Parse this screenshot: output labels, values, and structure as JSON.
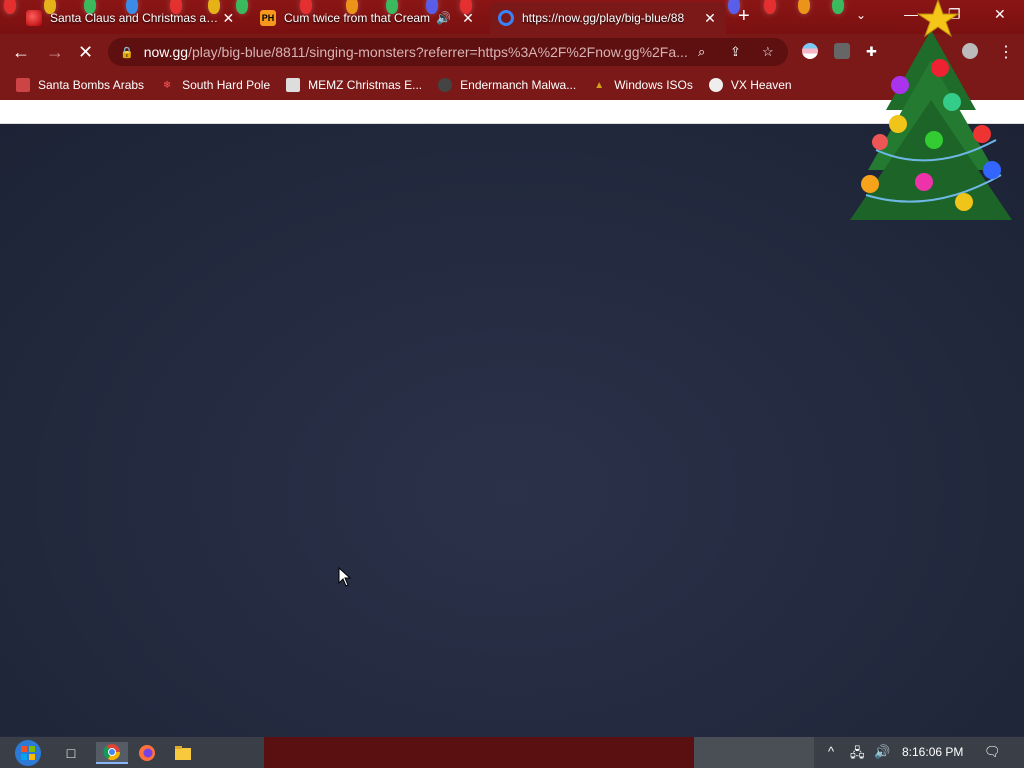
{
  "tabs": [
    {
      "title": "Santa Claus and Christmas at the",
      "favicon": "santa-icon",
      "close": "✕"
    },
    {
      "title": "Cum twice from that Cream",
      "favicon": "ph-icon",
      "favicon_text": "PH",
      "audio": "🔊",
      "close": "✕"
    },
    {
      "title": "https://now.gg/play/big-blue/88",
      "favicon": "nowgg-icon",
      "close": "✕"
    }
  ],
  "new_tab_label": "+",
  "tab_search": "⌄",
  "window_controls": {
    "minimize": "—",
    "restore": "❐",
    "close": "✕"
  },
  "toolbar": {
    "back": "←",
    "forward": "→",
    "stop": "✕",
    "url_host": "now.gg",
    "url_rest": "/play/big-blue/8811/singing-monsters?referrer=https%3A%2F%2Fnow.gg%2Fa...",
    "icons": {
      "search": "⌕",
      "share": "⇪",
      "star": "☆",
      "extensions": "✚",
      "menu": "⋮"
    }
  },
  "bookmarks": [
    {
      "label": "Santa Bombs Arabs",
      "icon": "santa-icon"
    },
    {
      "label": "South Hard Pole",
      "icon": "snowflake-icon"
    },
    {
      "label": "MEMZ Christmas E...",
      "icon": "memz-icon"
    },
    {
      "label": "Endermanch Malwa...",
      "icon": "enderman-icon"
    },
    {
      "label": "Windows ISOs",
      "icon": "tree-icon"
    },
    {
      "label": "VX Heaven",
      "icon": "vx-icon"
    }
  ],
  "taskbar": {
    "clock": "8:16:06 PM",
    "apps": [
      "start-orb-icon",
      "task-view-icon",
      "chrome-icon",
      "firefox-icon",
      "file-explorer-icon"
    ],
    "tray": {
      "chevron": "^",
      "network": "🖧",
      "volume": "🔊",
      "notifications": "🗨"
    }
  },
  "colors": {
    "chrome_frame": "#7b1818",
    "content_bg": "#232a3f",
    "taskbar": "#3a3f47"
  }
}
